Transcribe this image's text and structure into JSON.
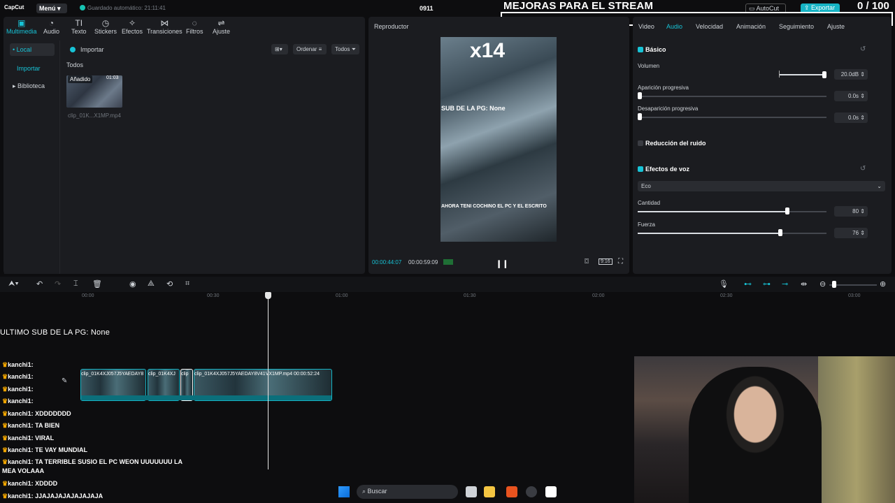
{
  "app": {
    "logo": "CapCut",
    "menu": "Menú",
    "autosave": "Guardado automático: 21:11:41",
    "project_name": "0911",
    "autocut": "AutoCut",
    "export": "Exportar"
  },
  "stream": {
    "title": "MEJORAS PARA EL STREAM",
    "counter": "0 / 100"
  },
  "media_tools": [
    {
      "label": "Multimedia",
      "icon": "media-icon"
    },
    {
      "label": "Audio",
      "icon": "audio-icon"
    },
    {
      "label": "Texto",
      "icon": "text-icon"
    },
    {
      "label": "Stickers",
      "icon": "sticker-icon"
    },
    {
      "label": "Efectos",
      "icon": "effects-icon"
    },
    {
      "label": "Transiciones",
      "icon": "transition-icon"
    },
    {
      "label": "Filtros",
      "icon": "filter-icon"
    },
    {
      "label": "Ajuste",
      "icon": "adjust-icon"
    }
  ],
  "left_nav": {
    "local": "• Local",
    "importar": "Importar",
    "biblioteca": "▸ Biblioteca"
  },
  "media": {
    "import_button": "Importar",
    "filter_all": "Todos",
    "sort": "Ordenar",
    "todos": "Todos",
    "clip_tag": "Añadido",
    "clip_duration": "01:03",
    "clip_name": "clip_01K...X1MP.mp4"
  },
  "player": {
    "title": "Reproductor",
    "overlay_big": "x14",
    "overlay_sub": "SUB DE LA PG: None",
    "overlay_text": "AHORA TENI COCHINO EL PC Y EL ESCRITO",
    "time_current": "00:00:44:07",
    "time_total": "00:00:59:09",
    "ratio": "9:16"
  },
  "inspector": {
    "tabs": [
      "Video",
      "Audio",
      "Velocidad",
      "Animación",
      "Seguimiento",
      "Ajuste"
    ],
    "active_tab": "Audio",
    "basico": "Básico",
    "volumen_label": "Volumen",
    "volumen_value": "20.0dB",
    "volumen_level": 1.0,
    "aparicion_label": "Aparición progresiva",
    "aparicion_value": "0.0s",
    "desaparicion_label": "Desaparición progresiva",
    "desaparicion_value": "0.0s",
    "reduccion": "Reducción del ruido",
    "efectos_voz": "Efectos de voz",
    "efecto_selected": "Eco",
    "cantidad_label": "Cantidad",
    "cantidad_value": "80",
    "fuerza_label": "Fuerza",
    "fuerza_value": "76"
  },
  "timeline": {
    "ruler": [
      "00:00",
      "00:30",
      "01:00",
      "01:30",
      "02:00",
      "02:30",
      "03:00"
    ],
    "clip_labels": [
      "clip_01K4XJ057J5YAEDAY8",
      "clip_01K4XJ",
      "clip",
      "clip_01K4XJ057J5YAEDAY8V41VX1MP.mp4   00:00:52:24"
    ]
  },
  "overlays": {
    "sub_line": "ULTIMO SUB DE LA PG: None",
    "chat": [
      {
        "user": "kanchi1:",
        "msg": ""
      },
      {
        "user": "kanchi1:",
        "msg": ""
      },
      {
        "user": "kanchi1:",
        "msg": ""
      },
      {
        "user": "kanchi1:",
        "msg": ""
      },
      {
        "user": "kanchi1:",
        "msg": "XDDDDDDD"
      },
      {
        "user": "kanchi1:",
        "msg": "TA BIEN"
      },
      {
        "user": "kanchi1:",
        "msg": "VIRAL"
      },
      {
        "user": "kanchi1:",
        "msg": "TE VAY MUNDIAL"
      },
      {
        "user": "kanchi1:",
        "msg": "TA TERRIBLE SUSIO EL PC WEON UUUUUUU LA"
      },
      {
        "user": "",
        "msg": "MEA VOLAAA"
      },
      {
        "user": "kanchi1:",
        "msg": "XDDDD"
      },
      {
        "user": "kanchi1:",
        "msg": "JJAJAJAJAJAJAJAJA"
      }
    ]
  },
  "taskbar": {
    "search": "Buscar"
  },
  "colors": {
    "accent": "#17c3d6",
    "panel": "#1b1c20",
    "background": "#0d0d0f",
    "clip_border": "#16b3c4"
  }
}
